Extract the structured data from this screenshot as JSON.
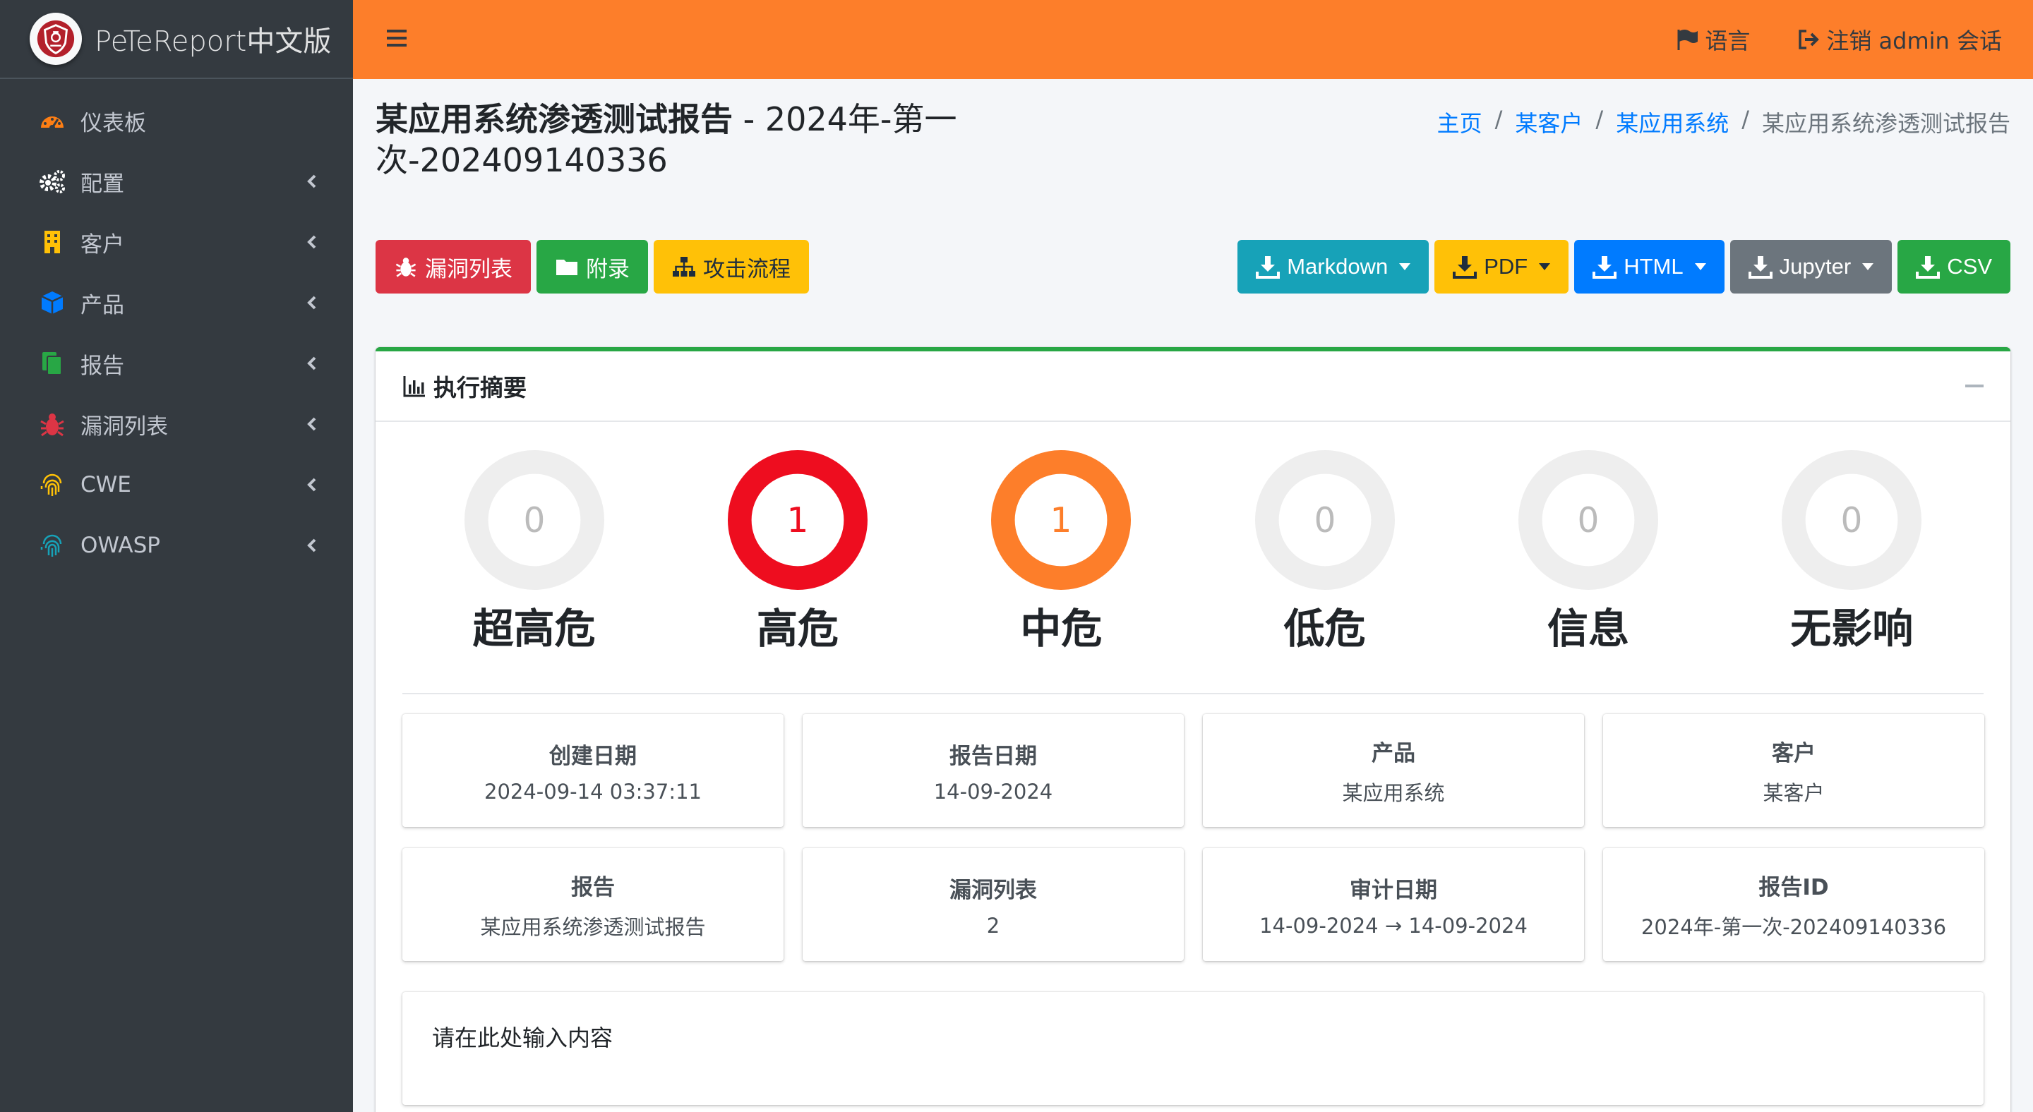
{
  "brand": {
    "name": "PeTeReport中文版"
  },
  "sidebar": {
    "items": [
      {
        "label": "仪表板",
        "icon": "dashboard-icon",
        "color": "#fd7e14",
        "has_children": false
      },
      {
        "label": "配置",
        "icon": "cogs-icon",
        "color": "#ffffff",
        "has_children": true
      },
      {
        "label": "客户",
        "icon": "building-icon",
        "color": "#ffc107",
        "has_children": true
      },
      {
        "label": "产品",
        "icon": "cube-icon",
        "color": "#007bff",
        "has_children": true
      },
      {
        "label": "报告",
        "icon": "copy-icon",
        "color": "#28a745",
        "has_children": true
      },
      {
        "label": "漏洞列表",
        "icon": "bug-icon",
        "color": "#dc3545",
        "has_children": true
      },
      {
        "label": "CWE",
        "icon": "fingerprint-icon",
        "color": "#ffc107",
        "has_children": true
      },
      {
        "label": "OWASP",
        "icon": "fingerprint-icon",
        "color": "#17a2b8",
        "has_children": true
      }
    ]
  },
  "topbar": {
    "language_label": "语言",
    "logout_label": "注销 admin 会话"
  },
  "page": {
    "title_main": "某应用系统渗透测试报告",
    "title_sub": " - 2024年-第一次-202409140336"
  },
  "breadcrumb": {
    "home": "主页",
    "client": "某客户",
    "product": "某应用系统",
    "current": "某应用系统渗透测试报告"
  },
  "actions_left": {
    "findings": "漏洞列表",
    "appendix": "附录",
    "attack_flow": "攻击流程"
  },
  "actions_right": {
    "markdown": "Markdown",
    "pdf": "PDF",
    "html": "HTML",
    "jupyter": "Jupyter",
    "csv": "CSV"
  },
  "summary": {
    "title": "执行摘要",
    "severities": [
      {
        "label": "超高危",
        "count": "0",
        "color": "#eeeeee",
        "text_color": "#bbbbbb"
      },
      {
        "label": "高危",
        "count": "1",
        "color": "#ee0d1f",
        "text_color": "#ee0d1f"
      },
      {
        "label": "中危",
        "count": "1",
        "color": "#fd7e2a",
        "text_color": "#fd7e2a"
      },
      {
        "label": "低危",
        "count": "0",
        "color": "#eeeeee",
        "text_color": "#bbbbbb"
      },
      {
        "label": "信息",
        "count": "0",
        "color": "#eeeeee",
        "text_color": "#bbbbbb"
      },
      {
        "label": "无影响",
        "count": "0",
        "color": "#eeeeee",
        "text_color": "#bbbbbb"
      }
    ],
    "info": [
      {
        "title": "创建日期",
        "value": "2024-09-14 03:37:11"
      },
      {
        "title": "报告日期",
        "value": "14-09-2024"
      },
      {
        "title": "产品",
        "value": "某应用系统"
      },
      {
        "title": "客户",
        "value": "某客户"
      },
      {
        "title": "报告",
        "value": "某应用系统渗透测试报告"
      },
      {
        "title": "漏洞列表",
        "value": "2"
      },
      {
        "title": "审计日期",
        "value": "14-09-2024 → 14-09-2024"
      },
      {
        "title": "报告ID",
        "value": "2024年-第一次-202409140336"
      }
    ],
    "note": "请在此处输入内容"
  }
}
